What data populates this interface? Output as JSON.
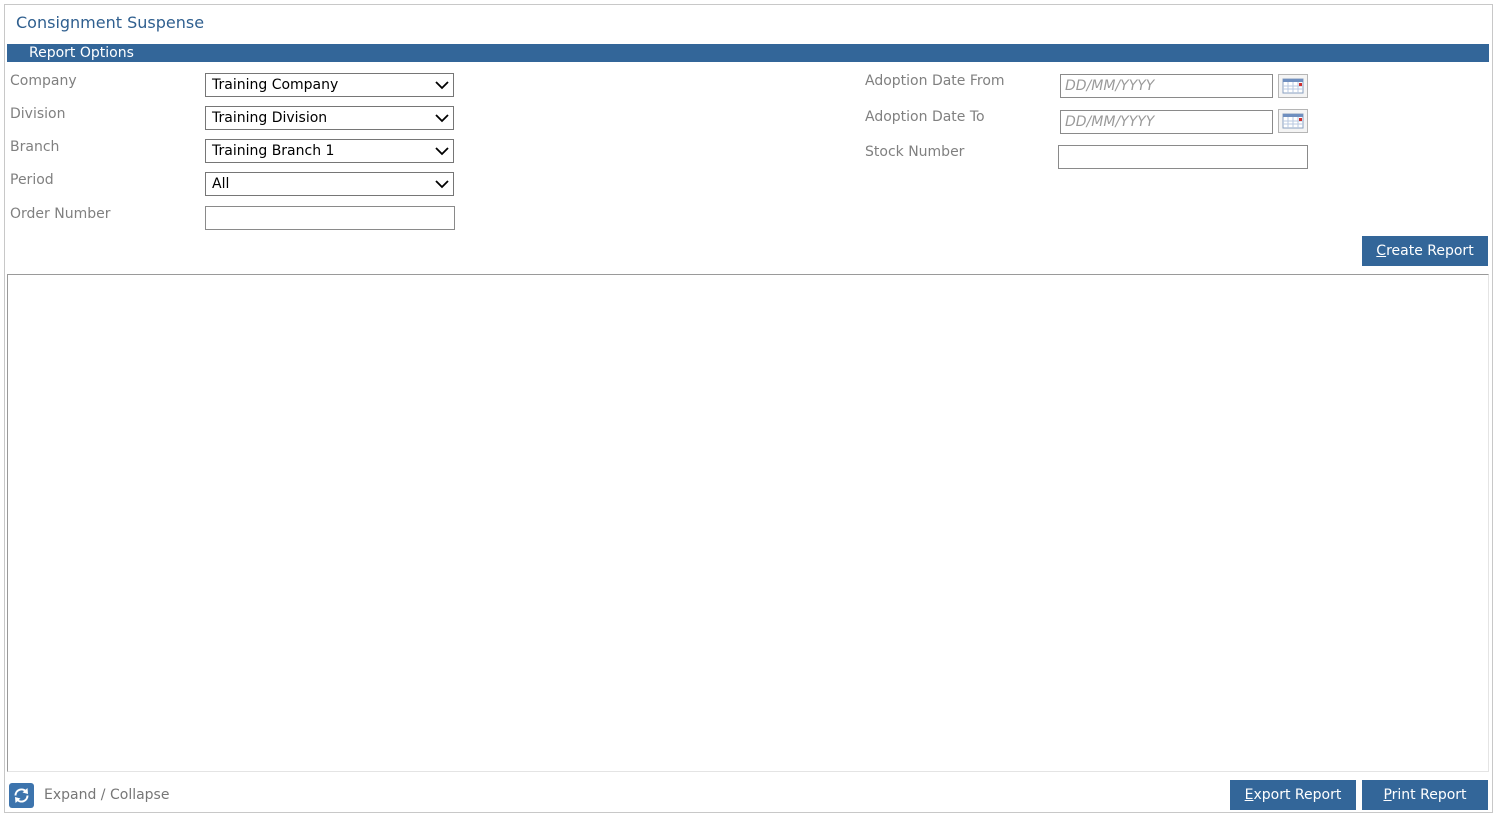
{
  "page": {
    "title": "Consignment Suspense"
  },
  "report_options": {
    "header": "Report Options",
    "company": {
      "label": "Company",
      "value": "Training Company"
    },
    "division": {
      "label": "Division",
      "value": "Training Division"
    },
    "branch": {
      "label": "Branch",
      "value": "Training Branch 1"
    },
    "period": {
      "label": "Period",
      "value": "All"
    },
    "order_number": {
      "label": "Order Number",
      "value": ""
    },
    "adoption_date_from": {
      "label": "Adoption Date From",
      "placeholder": "DD/MM/YYYY"
    },
    "adoption_date_to": {
      "label": "Adoption Date To",
      "placeholder": "DD/MM/YYYY"
    },
    "stock_number": {
      "label": "Stock Number",
      "value": ""
    }
  },
  "buttons": {
    "create_report": {
      "accesskey": "C",
      "rest": "reate Report"
    },
    "export_report": {
      "accesskey": "E",
      "rest": "xport Report"
    },
    "print_report": {
      "accesskey": "P",
      "rest": "rint Report"
    }
  },
  "footer": {
    "expand_collapse": "Expand / Collapse"
  },
  "icons": {
    "dropdown": "chevron-down-icon",
    "calendar": "calendar-icon",
    "expand": "refresh-icon"
  },
  "colors": {
    "accent": "#336699",
    "title": "#2f5f8f",
    "label": "#808080"
  }
}
